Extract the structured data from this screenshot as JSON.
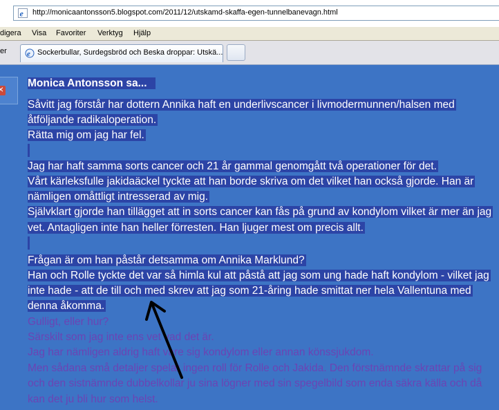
{
  "browser": {
    "url": "http://monicaantonsson5.blogspot.com/2011/12/utskamd-skaffa-egen-tunnelbanevagn.html",
    "menu": [
      "digera",
      "Visa",
      "Favoriter",
      "Verktyg",
      "Hjälp"
    ],
    "tab_prev_label": "er",
    "tab_title": "Sockerbullar, Surdegsbröd och Beska droppar: Utskä..."
  },
  "comment": {
    "author": "Monica Antonsson sa...",
    "selected_lines": [
      "Såvitt jag förstår har dottern Annika haft en underlivscancer i livmodermunnen/halsen med",
      "åtföljande radikaloperation.",
      "Rätta mig om jag har fel.",
      "",
      "Jag har haft samma sorts cancer och 21 år gammal genomgått två operationer för det.",
      "Vårt kärleksfulle jakidaäckel tyckte att han borde skriva om det vilket han också gjorde. Han är",
      "nämligen omåttligt intresserad av mig.",
      "Självklart gjorde han tillägget att in sorts cancer kan fås på grund av kondylom vilket är mer än jag",
      "vet. Antagligen inte han heller förresten. Han ljuger mest om precis allt.",
      "",
      "Frågan är om han påstår detsamma om Annika Marklund?",
      "Han och Rolle tyckte det var så himla kul att påstå att jag som ung hade haft kondylom - vilket jag",
      "inte hade - att de till och med skrev att jag som 21-åring hade smittat ner hela Vallentuna med",
      "denna åkomma."
    ],
    "plain_lines": [
      "Gulligt, eller hur?",
      "Särskilt som jag inte ens vet vad det är.",
      "Jag har nämligen aldrig haft vare sig kondylom eller annan könssjukdom.",
      "Men sådana små detaljer spelar ingen roll för Rolle och Jakida. Den förstnämnde skrattar på sig",
      "och den sistnämnde dubbelkollar ju sina lögner med sin spegelbild som enda säkra källa och då",
      "kan det ju bli hur som helst."
    ]
  },
  "colors": {
    "page_bg": "#3d74c5",
    "selection_bg": "#2c44a6",
    "plain_text": "#6b44b4"
  }
}
